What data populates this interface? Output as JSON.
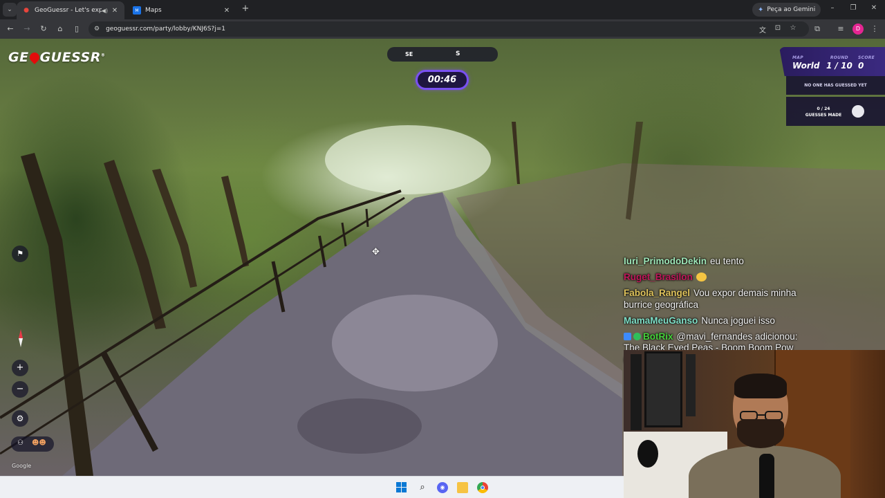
{
  "browser": {
    "tabs": [
      {
        "title": "GeoGuessr - Let's explore the world!",
        "active": true
      },
      {
        "title": "Maps",
        "active": false
      }
    ],
    "new_tab_symbol": "+",
    "gemini_button": "Peça ao Gemini",
    "url": "geoguessr.com/party/lobby/KNJ6S?j=1",
    "profile_initial": "D",
    "window_controls": {
      "minimize": "–",
      "restore": "❐",
      "close": "✕"
    }
  },
  "game": {
    "logo": {
      "left": "GE",
      "right": "GUESSR",
      "mark": "®"
    },
    "compass": {
      "left": "SE",
      "center": "S"
    },
    "timer": "00:46",
    "status": {
      "map_label": "MAP",
      "map_value": "World",
      "round_label": "ROUND",
      "round_value": "1 / 10",
      "score_label": "SCORE",
      "score_value": "0",
      "message": "NO ONE HAS GUESSED YET",
      "guesses_count": "0 / 24",
      "guesses_label": "GUESSES MADE"
    },
    "controls": {
      "zoom_in": "+",
      "zoom_out": "−"
    },
    "attribution": "Google",
    "accent_color": "#7950f2"
  },
  "chat": {
    "messages": [
      {
        "user": "Iuri_PrimodoDekin",
        "user_color": "#9ee6b8",
        "text": "eu tento"
      },
      {
        "user": "Ruget_Brasilon",
        "user_color": "#c2185b",
        "text": "",
        "emote": "smile-emote"
      },
      {
        "user": "Fabola_Rangel",
        "user_color": "#e0c45c",
        "text": "Vou expor demais minha burrice geográfica"
      },
      {
        "user": "MamaMeuGanso",
        "user_color": "#7fe0c8",
        "text": "Nunca joguei isso"
      },
      {
        "user": "BotRix",
        "user_color": "#45d13a",
        "text": "@mavi_fernandes adicionou: The Black Eyed Peas - Boom Boom Pow (Official Music Video) na playlist."
      }
    ]
  },
  "taskbar": {
    "icons": [
      "windows-start-icon",
      "search-icon",
      "discord-icon",
      "file-explorer-icon",
      "chrome-icon"
    ]
  }
}
